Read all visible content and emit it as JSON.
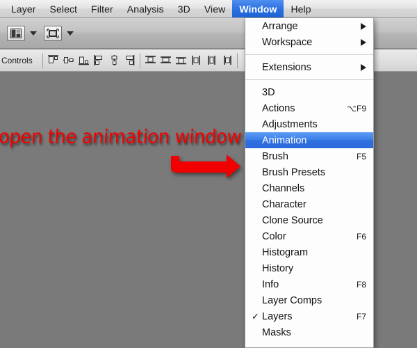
{
  "menubar": {
    "items": [
      {
        "label": "Layer",
        "active": false
      },
      {
        "label": "Select",
        "active": false
      },
      {
        "label": "Filter",
        "active": false
      },
      {
        "label": "Analysis",
        "active": false
      },
      {
        "label": "3D",
        "active": false
      },
      {
        "label": "View",
        "active": false
      },
      {
        "label": "Window",
        "active": true
      },
      {
        "label": "Help",
        "active": false
      }
    ]
  },
  "options_bar": {
    "buttons": [
      {
        "icon": "panel-layout-icon",
        "has_caret": true
      },
      {
        "icon": "screen-mode-icon",
        "has_caret": true
      }
    ]
  },
  "panel_bar": {
    "label": "n Controls",
    "align_group_1": [
      "align-top-edges-icon",
      "align-vertical-centers-icon",
      "align-bottom-edges-icon",
      "align-left-edges-icon",
      "align-horizontal-centers-icon",
      "align-right-edges-icon"
    ],
    "align_group_2": [
      "distribute-top-edges-icon",
      "distribute-vertical-centers-icon",
      "distribute-bottom-edges-icon",
      "distribute-left-edges-icon",
      "distribute-horizontal-centers-icon",
      "distribute-right-edges-icon"
    ]
  },
  "annotation": {
    "text": "open the animation window",
    "color": "#f20000",
    "arrow": "right-arrow-annotation"
  },
  "dropdown": {
    "title": "Window",
    "highlight_color": "#3a7ce8",
    "items": [
      {
        "label": "Arrange",
        "shortcut": "",
        "submenu": true,
        "checked": false,
        "highlight": false
      },
      {
        "label": "Workspace",
        "shortcut": "",
        "submenu": true,
        "checked": false,
        "highlight": false
      },
      {
        "separator": true
      },
      {
        "label": "Extensions",
        "shortcut": "",
        "submenu": true,
        "checked": false,
        "highlight": false
      },
      {
        "separator": true
      },
      {
        "label": "3D",
        "shortcut": "",
        "submenu": false,
        "checked": false,
        "highlight": false
      },
      {
        "label": "Actions",
        "shortcut": "⌥F9",
        "submenu": false,
        "checked": false,
        "highlight": false
      },
      {
        "label": "Adjustments",
        "shortcut": "",
        "submenu": false,
        "checked": false,
        "highlight": false
      },
      {
        "label": "Animation",
        "shortcut": "",
        "submenu": false,
        "checked": false,
        "highlight": true
      },
      {
        "label": "Brush",
        "shortcut": "F5",
        "submenu": false,
        "checked": false,
        "highlight": false
      },
      {
        "label": "Brush Presets",
        "shortcut": "",
        "submenu": false,
        "checked": false,
        "highlight": false
      },
      {
        "label": "Channels",
        "shortcut": "",
        "submenu": false,
        "checked": false,
        "highlight": false
      },
      {
        "label": "Character",
        "shortcut": "",
        "submenu": false,
        "checked": false,
        "highlight": false
      },
      {
        "label": "Clone Source",
        "shortcut": "",
        "submenu": false,
        "checked": false,
        "highlight": false
      },
      {
        "label": "Color",
        "shortcut": "F6",
        "submenu": false,
        "checked": false,
        "highlight": false
      },
      {
        "label": "Histogram",
        "shortcut": "",
        "submenu": false,
        "checked": false,
        "highlight": false
      },
      {
        "label": "History",
        "shortcut": "",
        "submenu": false,
        "checked": false,
        "highlight": false
      },
      {
        "label": "Info",
        "shortcut": "F8",
        "submenu": false,
        "checked": false,
        "highlight": false
      },
      {
        "label": "Layer Comps",
        "shortcut": "",
        "submenu": false,
        "checked": false,
        "highlight": false
      },
      {
        "label": "Layers",
        "shortcut": "F7",
        "submenu": false,
        "checked": true,
        "highlight": false
      },
      {
        "label": "Masks",
        "shortcut": "",
        "submenu": false,
        "checked": false,
        "highlight": false
      }
    ]
  }
}
